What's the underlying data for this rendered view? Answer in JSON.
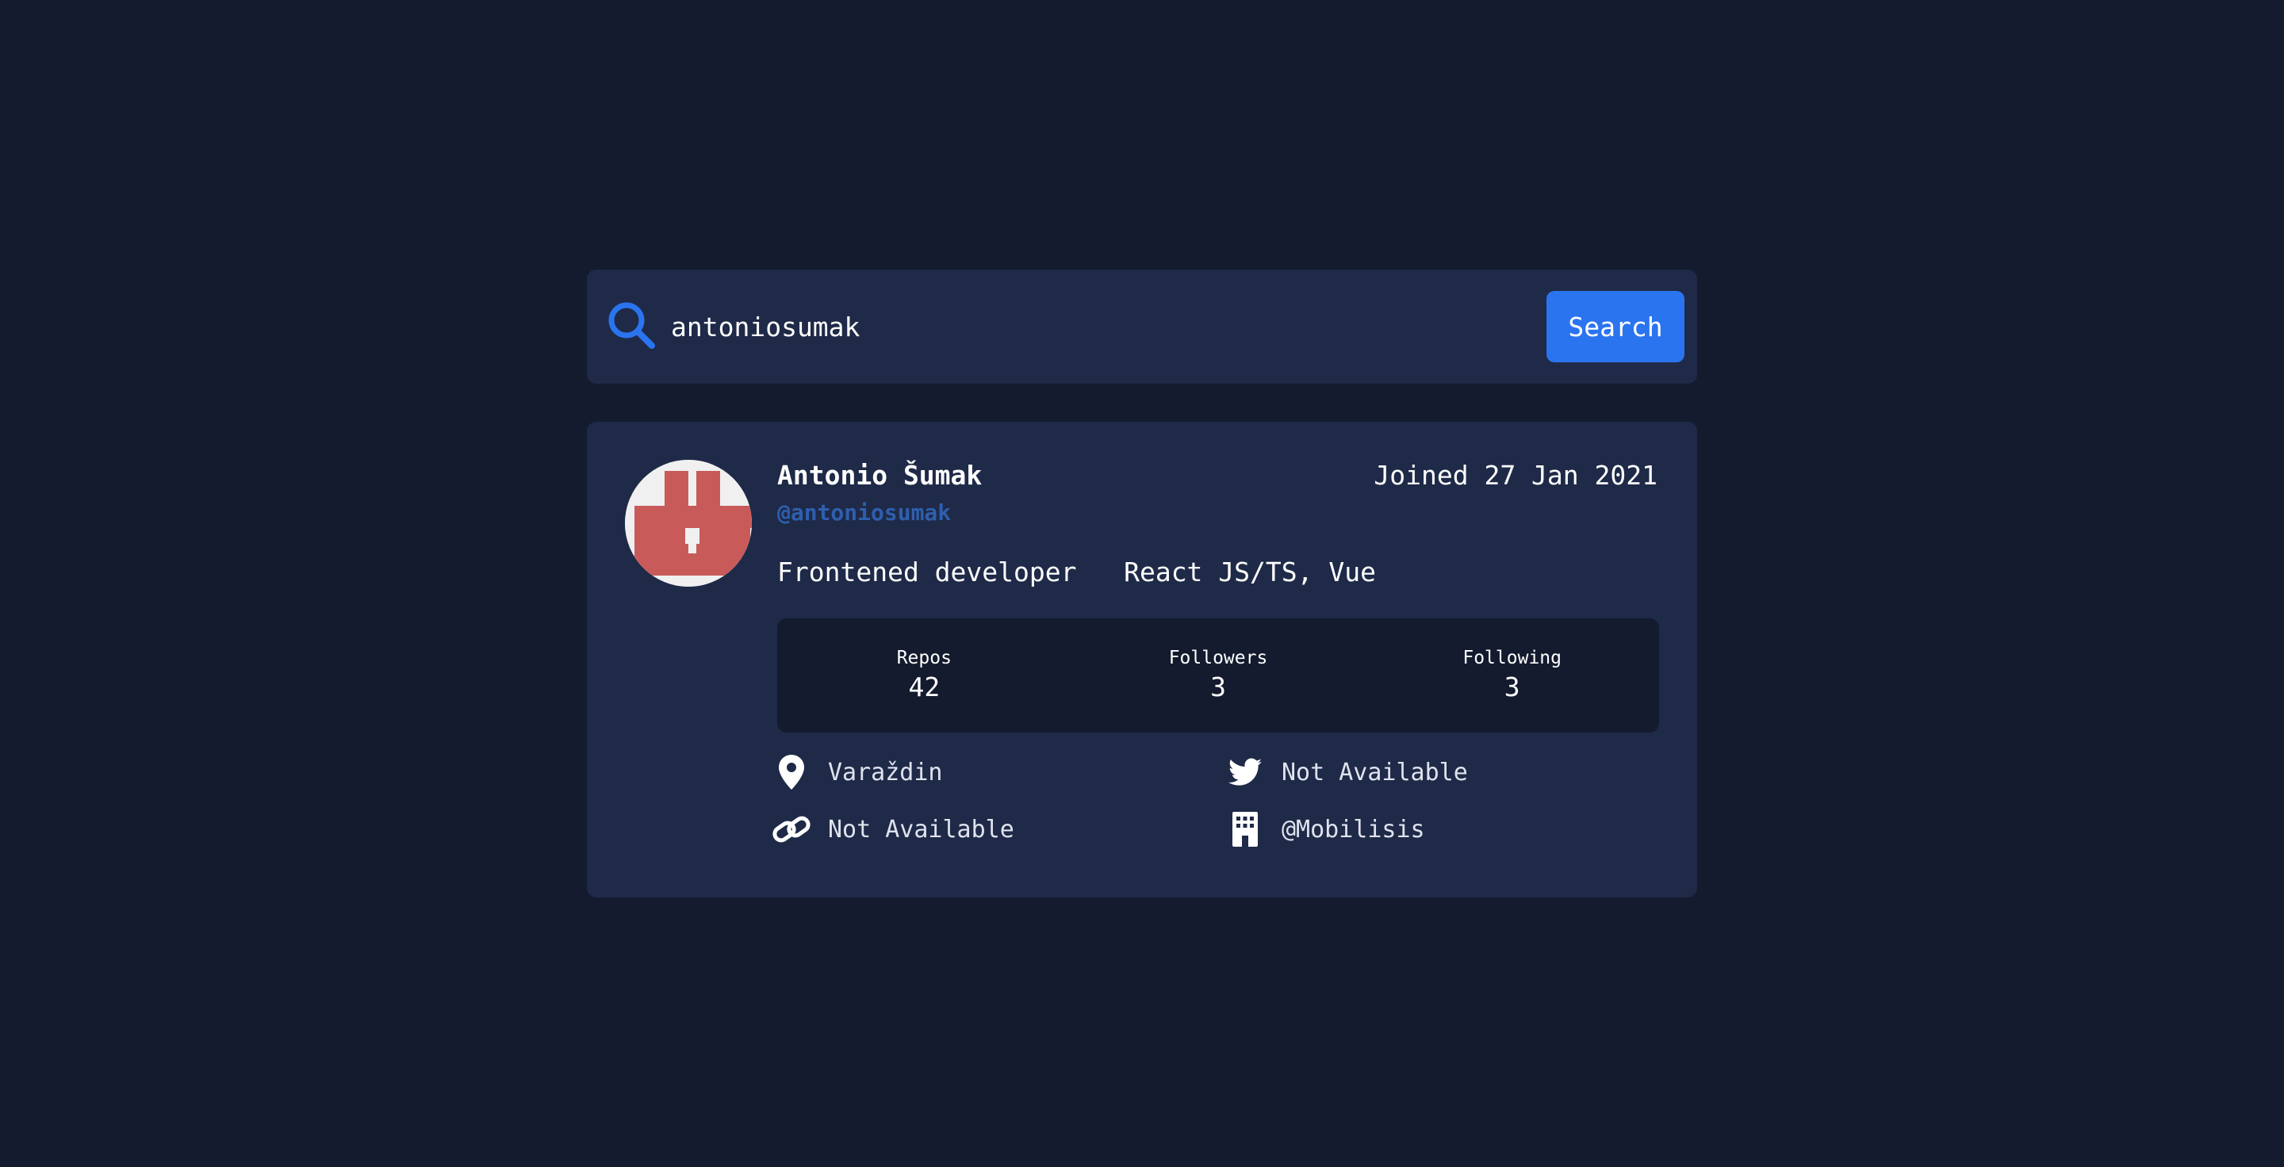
{
  "search": {
    "value": "antoniosumak",
    "placeholder": "Search GitHub username…",
    "button_label": "Search"
  },
  "profile": {
    "name": "Antonio Šumak",
    "login": "@antoniosumak",
    "joined": "Joined 27 Jan 2021",
    "bio": "Frontened developer   React JS/TS, Vue",
    "avatar_icon": "identicon-avatar",
    "avatar_color": "#c95a5a"
  },
  "stats": [
    {
      "label": "Repos",
      "value": "42"
    },
    {
      "label": "Followers",
      "value": "3"
    },
    {
      "label": "Following",
      "value": "3"
    }
  ],
  "links": {
    "location": {
      "icon": "location-pin-icon",
      "text": "Varaždin"
    },
    "twitter": {
      "icon": "twitter-icon",
      "text": "Not Available"
    },
    "website": {
      "icon": "link-icon",
      "text": "Not Available"
    },
    "company": {
      "icon": "building-icon",
      "text": "@Mobilisis"
    }
  },
  "colors": {
    "background": "#141b2e",
    "card": "#1f2a48",
    "accent": "#2b74f0",
    "login": "#2e5fae"
  }
}
